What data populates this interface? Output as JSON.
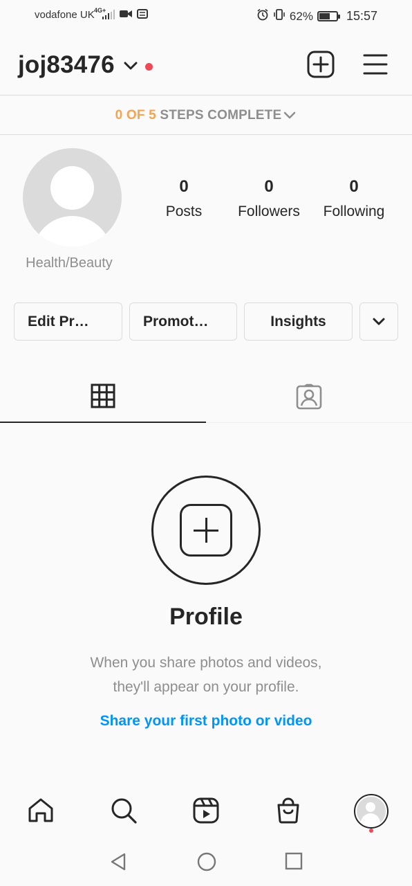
{
  "status_bar": {
    "carrier": "vodafone UK",
    "network": "4G+",
    "battery": "62%",
    "battery_level": 0.62,
    "time": "15:57"
  },
  "header": {
    "username": "joj83476",
    "icons": [
      "chevron-down-icon",
      "notification-dot",
      "new-post-icon",
      "menu-icon"
    ]
  },
  "steps": {
    "progress": "0 OF 5",
    "label": "STEPS COMPLETE"
  },
  "profile": {
    "category": "Health/Beauty",
    "stats": [
      {
        "value": "0",
        "label": "Posts"
      },
      {
        "value": "0",
        "label": "Followers"
      },
      {
        "value": "0",
        "label": "Following"
      }
    ]
  },
  "buttons": {
    "edit": "Edit Pr…",
    "promote": "Promot…",
    "insights": "Insights"
  },
  "tabs": [
    "grid-icon",
    "tagged-icon"
  ],
  "empty_state": {
    "title": "Profile",
    "desc_line1": "When you share photos and videos,",
    "desc_line2": "they'll appear on your profile.",
    "link": "Share your first photo or video"
  },
  "bottom_nav": [
    "home-icon",
    "search-icon",
    "reels-icon",
    "shop-icon",
    "profile-avatar"
  ],
  "colors": {
    "accent_blue": "#0095f6",
    "progress_orange": "#f6a34f",
    "notification_red": "#ed4956",
    "text_primary": "#262626",
    "text_secondary": "#8e8e8e"
  }
}
